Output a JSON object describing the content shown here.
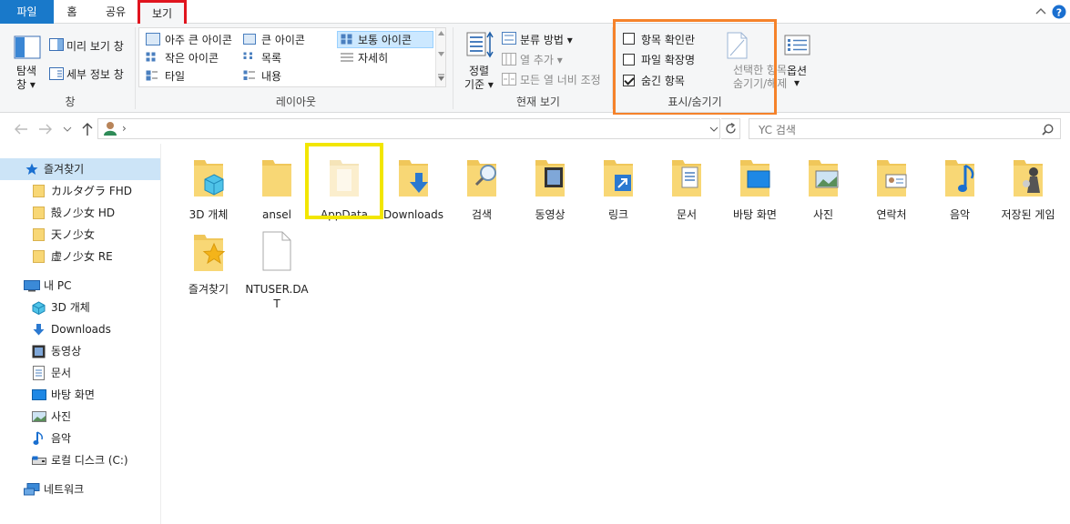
{
  "tabs": {
    "file": "파일",
    "home": "홈",
    "share": "공유",
    "view": "보기"
  },
  "ribbon": {
    "panes": {
      "navigation_pane": "탐색\n창",
      "navigation_pane_l1": "탐색",
      "navigation_pane_l2": "창",
      "preview_pane": "미리 보기 창",
      "details_pane": "세부 정보 창",
      "label": "창"
    },
    "layout": {
      "extra_large": "아주 큰 아이콘",
      "large": "큰 아이콘",
      "medium": "보통 아이콘",
      "small": "작은 아이콘",
      "list": "목록",
      "details": "자세히",
      "tiles": "타일",
      "content": "내용",
      "label": "레이아웃"
    },
    "current_view": {
      "sort_l1": "정렬",
      "sort_l2": "기준",
      "group_by": "분류 방법",
      "add_columns": "열 추가",
      "size_all_columns": "모든 열 너비 조정",
      "label": "현재 보기"
    },
    "show_hide": {
      "item_check_boxes": "항목 확인란",
      "file_name_extensions": "파일 확장명",
      "hidden_items": "숨긴 항목",
      "hide_selected_l1": "선택한 항목",
      "hide_selected_l2": "숨기기/해제",
      "label": "표시/숨기기",
      "checked": {
        "item_check_boxes": false,
        "file_name_extensions": false,
        "hidden_items": true
      }
    },
    "options": "옵션"
  },
  "address": {
    "path_sep": "›",
    "search_placeholder": "YC 검색"
  },
  "sidebar": {
    "quick_access": "즐겨찾기",
    "pinned": [
      "カルタグラ FHD",
      "殻ノ少女 HD",
      "天ノ少女",
      "虚ノ少女 RE"
    ],
    "this_pc": "내 PC",
    "pc_items": [
      "3D 개체",
      "Downloads",
      "동영상",
      "문서",
      "바탕 화면",
      "사진",
      "음악",
      "로컬 디스크 (C:)"
    ],
    "network": "네트워크"
  },
  "items": [
    {
      "name": "3D 개체",
      "icon": "3d-objects-folder-icon"
    },
    {
      "name": "ansel",
      "icon": "folder-icon"
    },
    {
      "name": "AppData",
      "icon": "hidden-folder-icon"
    },
    {
      "name": "Downloads",
      "icon": "downloads-folder-icon"
    },
    {
      "name": "검색",
      "icon": "searches-folder-icon"
    },
    {
      "name": "동영상",
      "icon": "videos-folder-icon"
    },
    {
      "name": "링크",
      "icon": "links-folder-icon"
    },
    {
      "name": "문서",
      "icon": "documents-folder-icon"
    },
    {
      "name": "바탕 화면",
      "icon": "desktop-folder-icon"
    },
    {
      "name": "사진",
      "icon": "pictures-folder-icon"
    },
    {
      "name": "연락처",
      "icon": "contacts-folder-icon"
    },
    {
      "name": "음악",
      "icon": "music-folder-icon"
    },
    {
      "name": "저장된 게임",
      "icon": "saved-games-folder-icon"
    },
    {
      "name": "즐겨찾기",
      "icon": "favorites-folder-icon"
    },
    {
      "name": "NTUSER.DAT",
      "icon": "file-icon"
    }
  ],
  "colors": {
    "accent": "#1979ca",
    "red_highlight": "#e0141e",
    "orange_highlight": "#f5822a",
    "yellow_highlight": "#f2e600",
    "folder": "#f8d775"
  }
}
